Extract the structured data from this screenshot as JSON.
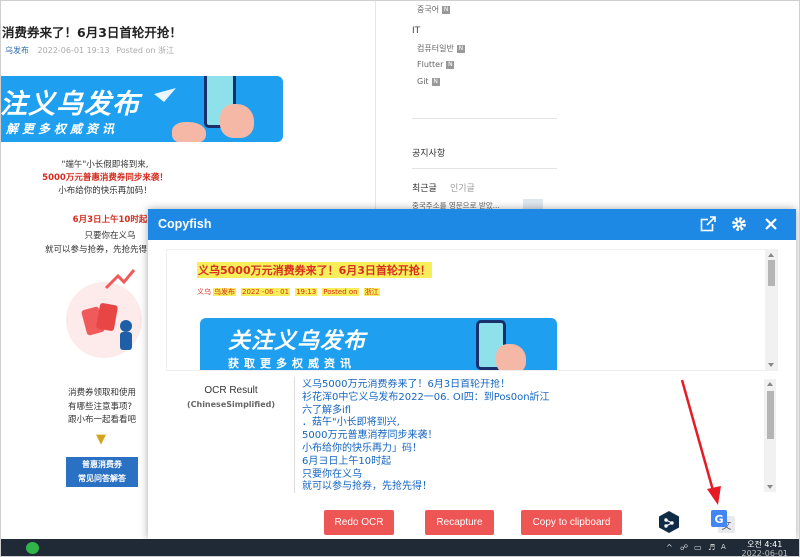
{
  "article": {
    "title": "消费券来了！6月3日首轮开抢！",
    "meta_source": "乌发布",
    "meta_date": "2022-06-01 19:13",
    "meta_posted": "Posted on 浙江",
    "banner_main": "注义乌发布",
    "banner_sub": "解更多权威资讯",
    "p1": "\"端午\"小长假即将到来,",
    "p2": "5000万元普惠消费券同步来袭！",
    "p3": "小布给你的快乐再加码！",
    "p4": "6月3日上午10时起",
    "p5": "只要你在义乌",
    "p6": "就可以参与抢券，先抢先得",
    "s1": "消费券领取和使用",
    "s2": "有哪些注意事项?",
    "s3": "跟小布一起看看吧",
    "box1": "普惠消费券",
    "box2": "常见问答解答"
  },
  "sidebar": {
    "item_korean": "중국어",
    "it_header": "IT",
    "items": [
      "컴퓨터일반",
      "Flutter",
      "Git"
    ],
    "notice": "공지사항",
    "tab_recent": "최근글",
    "tab_popular": "인기글",
    "recent_post": "중국주소를 영문으로 받았..."
  },
  "dialog": {
    "title": "Copyfish",
    "snapshot_line1": "义乌5000万元消费券来了！6月3日首轮开抢！",
    "snapshot_line2": [
      "义乌",
      "乌发布",
      "2022 -06 · 01",
      "19:13",
      "Posted on",
      "浙江"
    ],
    "snapshot_banner_main": "关注义乌发布",
    "snapshot_banner_sub": "获取更多权威资讯",
    "ocr_label": "OCR Result",
    "ocr_language": "(ChineseSimplified)",
    "ocr_text": "义乌5000万元消费券来了！6月3日首轮开抢！\n衫花浑0中它义乌发布2022一06. OI四：到Pos0on訢江\n六了解多ifl\n．菇午\"小长即将到兴,\n5000万元普惠消荐同步来袭！\n小布给你的快乐再力」码！\n6月ヨ日上午10时起\n只要你在义乌\n就可以参与抢券，先抢先得！",
    "buttons": {
      "redo": "Redo OCR",
      "recapture": "Recapture",
      "copy": "Copy to clipboard"
    }
  },
  "taskbar": {
    "time": "오전 4:41",
    "date": "2022-06-01"
  },
  "colors": {
    "dialog_header": "#1e88e5",
    "button_red": "#ee5555",
    "ocr_text": "#1565c0",
    "highlight": "#f7ee5a"
  }
}
